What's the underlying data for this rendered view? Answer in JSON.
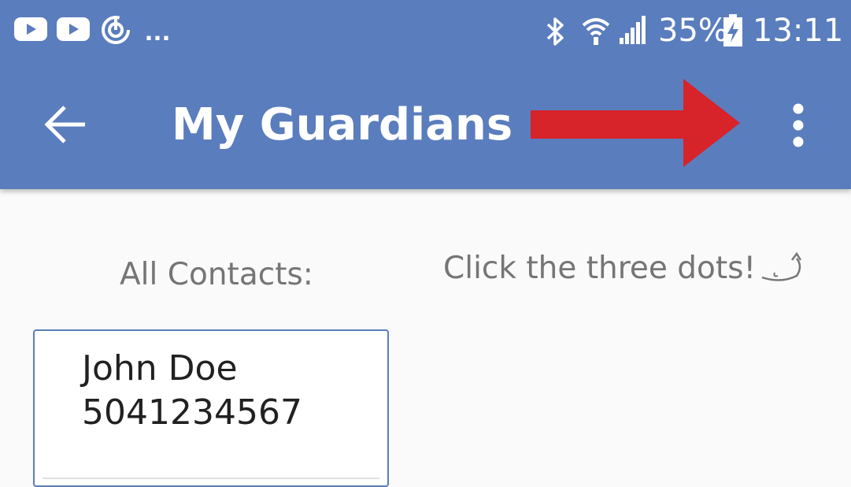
{
  "status_bar": {
    "notification_overflow": "...",
    "battery_percent": "35%",
    "time": "13:11",
    "icons": [
      "youtube-icon",
      "youtube-icon",
      "sync-icon",
      "bluetooth-icon",
      "wifi-icon",
      "signal-icon",
      "battery-charging-icon"
    ]
  },
  "toolbar": {
    "title": "My Guardians",
    "back_icon": "arrow-left-icon",
    "overflow_icon": "more-vert-icon"
  },
  "annotation": {
    "arrow_color": "#d7232a",
    "hint": "Click the three dots!"
  },
  "content": {
    "section_label": "All Contacts:",
    "contacts": [
      {
        "name": "John Doe",
        "phone": "5041234567"
      }
    ]
  },
  "colors": {
    "primary": "#5a7dbd",
    "background": "#fafafa",
    "secondary_text": "#757575",
    "primary_text": "#212121"
  }
}
